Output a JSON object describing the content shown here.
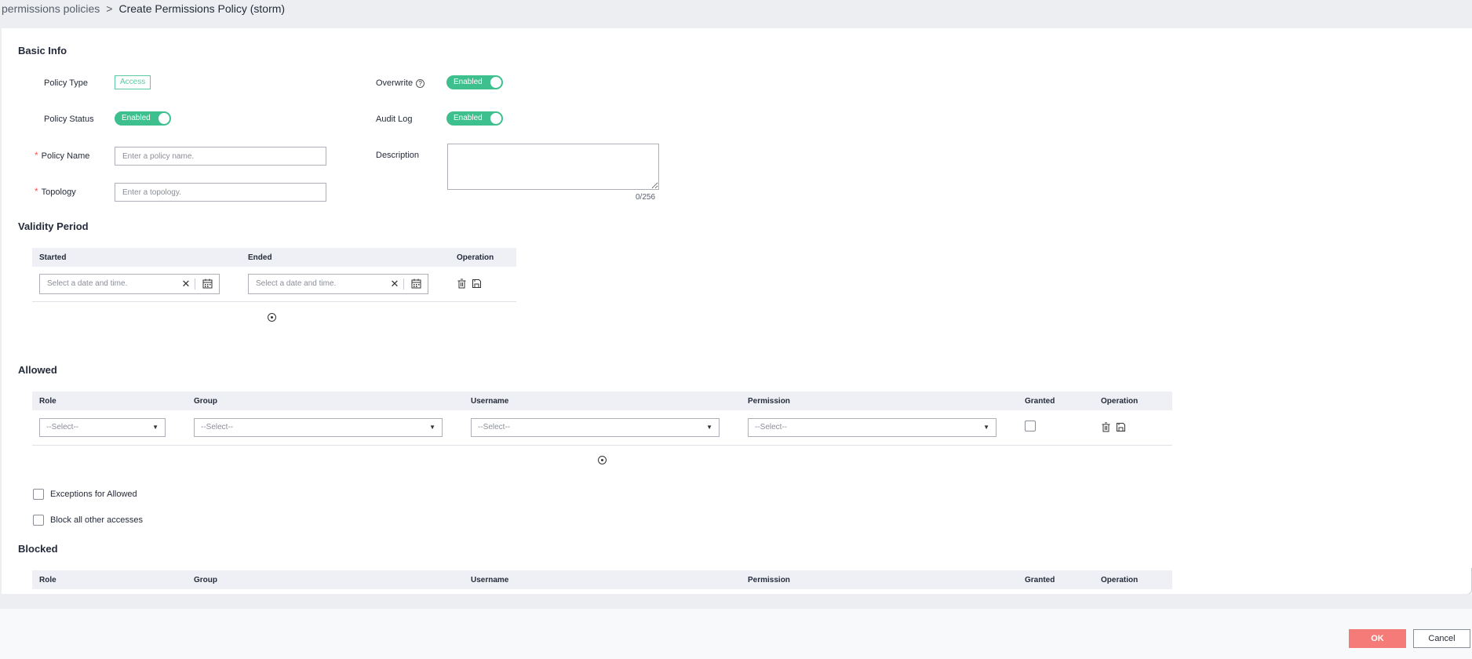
{
  "breadcrumb": {
    "parent": "permissions policies",
    "separator": ">",
    "current": "Create Permissions Policy  (storm)"
  },
  "basic_info": {
    "title": "Basic Info",
    "policy_type_label": "Policy Type",
    "policy_type_value": "Access",
    "overwrite_label": "Overwrite",
    "overwrite_value": "Enabled",
    "policy_status_label": "Policy Status",
    "policy_status_value": "Enabled",
    "audit_log_label": "Audit Log",
    "audit_log_value": "Enabled",
    "policy_name_label": "Policy Name",
    "policy_name_placeholder": "Enter a policy name.",
    "description_label": "Description",
    "description_counter": "0/256",
    "topology_label": "Topology",
    "topology_placeholder": "Enter a topology.",
    "required_mark": "*"
  },
  "validity": {
    "title": "Validity Period",
    "columns": [
      "Started",
      "Ended",
      "Operation"
    ],
    "date_placeholder": "Select a date and time."
  },
  "allowed": {
    "title": "Allowed",
    "columns": [
      "Role",
      "Group",
      "Username",
      "Permission",
      "Granted",
      "Operation"
    ],
    "select_placeholder": "--Select--"
  },
  "options": {
    "exceptions_label": "Exceptions for Allowed",
    "block_label": "Block all other accesses"
  },
  "blocked": {
    "title": "Blocked",
    "columns": [
      "Role",
      "Group",
      "Username",
      "Permission",
      "Granted",
      "Operation"
    ]
  },
  "footer": {
    "ok_label": "OK",
    "cancel_label": "Cancel"
  },
  "colors": {
    "accent": "#3dbf8e",
    "primary_button": "#f47b78",
    "required": "#ff5555",
    "header_bg": "#eef0f5"
  }
}
